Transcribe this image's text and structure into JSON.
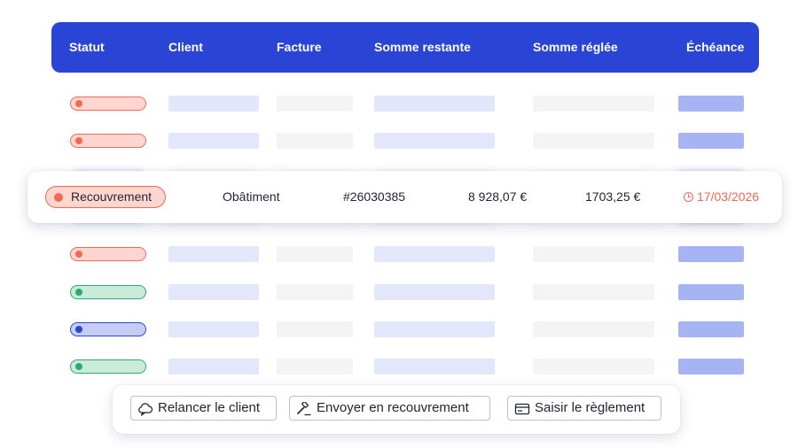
{
  "table": {
    "headers": [
      "Statut",
      "Client",
      "Facture",
      "Somme restante",
      "Somme réglée",
      "Échéance"
    ],
    "rows_status": [
      "red",
      "red",
      "ghost-blue",
      "ghost-green",
      "red",
      "green",
      "blue",
      "green"
    ]
  },
  "highlighted_row": {
    "status": "Recouvrement",
    "client": "Obâtiment",
    "facture": "#26030385",
    "somme_restante": "8 928,07 €",
    "somme_reglee": "1703,25 €",
    "echeance": "17/03/2026"
  },
  "actions": {
    "relancer": "Relancer le client",
    "envoyer": "Envoyer en recouvrement",
    "saisir": "Saisir le règlement"
  },
  "colors": {
    "primary": "#2a45d6",
    "status_red": "#f06a55",
    "status_green": "#2fa872",
    "status_blue": "#2a45d6",
    "placeholder_blue": "#e3e7fb",
    "placeholder_grey": "#f4f4f4",
    "placeholder_due": "#a7b4f3"
  },
  "icons": {
    "relancer": "cloud-message-icon",
    "envoyer": "gavel-icon",
    "saisir": "card-icon",
    "echeance": "clock-icon"
  }
}
